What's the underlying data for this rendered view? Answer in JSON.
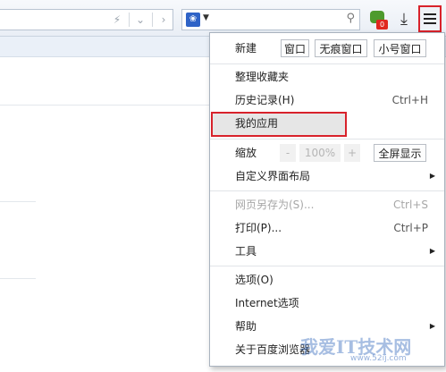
{
  "search": {
    "engine_icon": "paw-icon"
  },
  "toolbar": {
    "chat_badge": "0"
  },
  "menu": {
    "new_label": "新建",
    "new_window": "窗口",
    "incognito_window": "无痕窗口",
    "small_window": "小号窗口",
    "organize_favorites": "整理收藏夹",
    "history": "历史记录(H)",
    "history_shortcut": "Ctrl+H",
    "my_apps": "我的应用",
    "zoom_label": "缩放",
    "zoom_minus": "-",
    "zoom_value": "100%",
    "zoom_plus": "+",
    "fullscreen": "全屏显示",
    "customize_layout": "自定义界面布局",
    "save_as": "网页另存为(S)...",
    "save_as_shortcut": "Ctrl+S",
    "print": "打印(P)...",
    "print_shortcut": "Ctrl+P",
    "tools": "工具",
    "options": "选项(O)",
    "internet_options": "Internet选项",
    "help": "帮助",
    "about": "关于百度浏览器"
  },
  "watermark": {
    "text": "我爱IT技术网",
    "url": "www.52ij.com"
  }
}
